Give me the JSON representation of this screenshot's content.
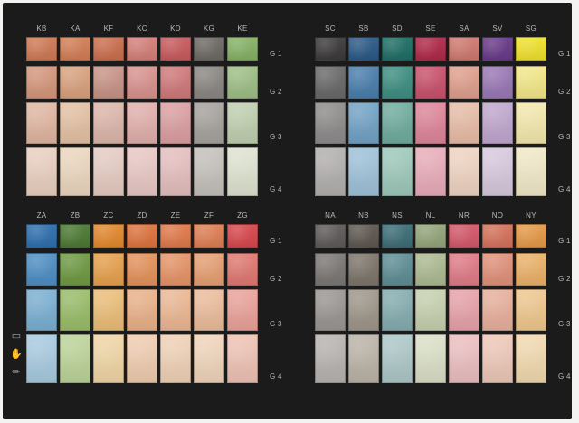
{
  "panels": [
    {
      "id": "top-left",
      "codes": [
        "KB",
        "KA",
        "KF",
        "KC",
        "KD",
        "KG",
        "KE"
      ],
      "groups": [
        "G 1",
        "G 2",
        "G 3",
        "G 4"
      ],
      "colors": [
        [
          "#cf7a55",
          "#d27e56",
          "#cc6f4f",
          "#d57f7a",
          "#c85b5e",
          "#6e6a66",
          "#86b266"
        ],
        [
          "#d5977c",
          "#d9a37f",
          "#c99488",
          "#d9938f",
          "#d07a7b",
          "#8b8884",
          "#9fbf86"
        ],
        [
          "#e1b7a2",
          "#e4c2a4",
          "#ddb7ab",
          "#e2b0ad",
          "#dca0a2",
          "#a7a39f",
          "#c0d0b0"
        ],
        [
          "#ead0c0",
          "#ecd7bf",
          "#e6ccc3",
          "#e8c8c5",
          "#e5bfbf",
          "#c5c1bc",
          "#dfe3d0"
        ]
      ]
    },
    {
      "id": "top-right",
      "codes": [
        "SC",
        "SB",
        "SD",
        "SE",
        "SA",
        "SV",
        "SG"
      ],
      "groups": [
        "G 1",
        "G 2",
        "G 3",
        "G 4"
      ],
      "colors": [
        [
          "#3d3b3c",
          "#2c5a86",
          "#1f6f66",
          "#b02a49",
          "#cf7a6f",
          "#6a3b8a",
          "#f0e12e"
        ],
        [
          "#6b6a6a",
          "#4b7fad",
          "#3f8f83",
          "#c9536d",
          "#e0a08e",
          "#9b79b6",
          "#f3e88a"
        ],
        [
          "#8f8d8c",
          "#73a3c6",
          "#70ad9f",
          "#de879a",
          "#e8bda8",
          "#c1a8cf",
          "#f3e9ae"
        ],
        [
          "#b3b0ae",
          "#9fc2d9",
          "#9ec9bb",
          "#e9adba",
          "#efd4c2",
          "#d8c9de",
          "#f1e9c8"
        ]
      ]
    },
    {
      "id": "bottom-left",
      "codes": [
        "ZA",
        "ZB",
        "ZC",
        "ZD",
        "ZE",
        "ZF",
        "ZG"
      ],
      "groups": [
        "G 1",
        "G 2",
        "G 3",
        "G 4"
      ],
      "colors": [
        [
          "#2f6fae",
          "#4d7a34",
          "#e3892f",
          "#de7440",
          "#e07a4c",
          "#df7f55",
          "#d8484d"
        ],
        [
          "#4f8fc4",
          "#6f9a44",
          "#e7a14e",
          "#e4935d",
          "#e6956a",
          "#e6a074",
          "#e07a72"
        ],
        [
          "#7cb0d3",
          "#9abd6a",
          "#ecbe79",
          "#eab28a",
          "#ecb895",
          "#ecbd9c",
          "#eaa39a"
        ],
        [
          "#a9cbe0",
          "#bdd49a",
          "#f0d6a6",
          "#efcdb0",
          "#f0d2b7",
          "#f0d5bc",
          "#efc3b5"
        ]
      ]
    },
    {
      "id": "bottom-right",
      "codes": [
        "NA",
        "NB",
        "NS",
        "NL",
        "NR",
        "NO",
        "NY"
      ],
      "groups": [
        "G 1",
        "G 2",
        "G 3",
        "G 4"
      ],
      "colors": [
        [
          "#5e5b5a",
          "#5f5851",
          "#3e6e78",
          "#94a67b",
          "#d4596a",
          "#d5735d",
          "#e59a49"
        ],
        [
          "#7c7876",
          "#7e766c",
          "#5f8f95",
          "#adbb93",
          "#e07c88",
          "#e1927b",
          "#ebb26b"
        ],
        [
          "#9b9794",
          "#a0978b",
          "#86aeb1",
          "#c7d1af",
          "#e7a3aa",
          "#e8b09e",
          "#efc88f"
        ],
        [
          "#b8b4b1",
          "#bcb4a8",
          "#aec8c8",
          "#dbe0c8",
          "#ecbfc1",
          "#eec9b9",
          "#f1dab0"
        ]
      ]
    }
  ],
  "side_icons": [
    "monitor-icon",
    "hand-icon",
    "brush-icon"
  ],
  "colors": {
    "background": "#1c1b1b",
    "text": "#b9b9b6",
    "paper": "#f3f3f1"
  }
}
